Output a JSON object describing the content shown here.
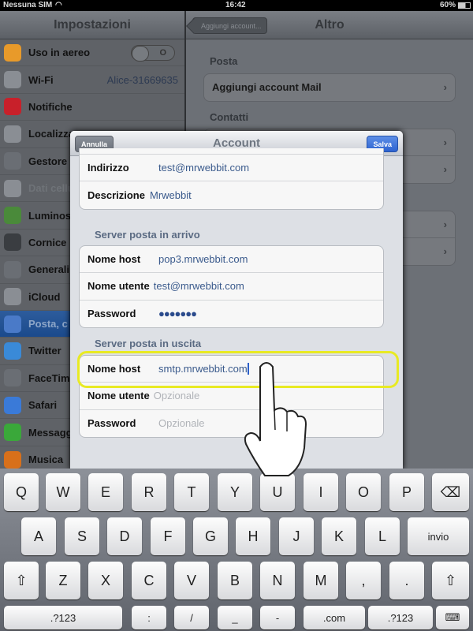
{
  "status_bar": {
    "carrier": "Nessuna SIM",
    "time": "16:42",
    "battery": "60%"
  },
  "sidebar": {
    "title": "Impostazioni",
    "items": [
      {
        "label": "Uso in aereo",
        "icon": "airplane-icon",
        "color": "#e89a2a",
        "toggle": "O"
      },
      {
        "label": "Wi-Fi",
        "icon": "wifi-icon",
        "color": "#8a8e94",
        "value": "Alice-31669635"
      },
      {
        "label": "Notifiche",
        "icon": "notifications-icon",
        "color": "#c8202a"
      },
      {
        "label": "Localizza",
        "icon": "location-icon",
        "color": "#8a8e94"
      },
      {
        "label": "Gestore",
        "icon": "carrier-icon",
        "color": "#6a6e74"
      },
      {
        "label": "Dati cellu",
        "icon": "cellular-data-icon",
        "color": "#8a8e94",
        "disabled": true
      },
      {
        "label": "Luminos",
        "icon": "brightness-icon",
        "color": "#4a8a3a"
      },
      {
        "label": "Cornice",
        "icon": "picture-frame-icon",
        "color": "#3a3d41"
      },
      {
        "label": "Generali",
        "icon": "gear-icon",
        "color": "#6a6e74"
      },
      {
        "label": "iCloud",
        "icon": "icloud-icon",
        "color": "#8a8e94"
      },
      {
        "label": "Posta, c",
        "icon": "mail-icon",
        "color": "#4a7ac8",
        "selected": true
      },
      {
        "label": "Twitter",
        "icon": "twitter-icon",
        "color": "#3a8ad8"
      },
      {
        "label": "FaceTim",
        "icon": "facetime-icon",
        "color": "#6a6e74"
      },
      {
        "label": "Safari",
        "icon": "safari-icon",
        "color": "#3a7ad8"
      },
      {
        "label": "Messagg",
        "icon": "messages-icon",
        "color": "#3aa83a"
      },
      {
        "label": "Musica",
        "icon": "music-icon",
        "color": "#d8701a"
      }
    ]
  },
  "main": {
    "back_label": "Aggiungi account...",
    "title": "Altro",
    "sections": [
      {
        "label": "Posta",
        "rows": [
          "Aggiungi account Mail"
        ]
      },
      {
        "label": "Contatti",
        "rows": [
          "",
          ""
        ]
      },
      {
        "label": "",
        "rows": [
          "",
          ""
        ]
      }
    ]
  },
  "modal": {
    "title": "Account",
    "cancel_label": "Annulla",
    "save_label": "Salva",
    "account_rows": [
      {
        "key": "Indirizzo",
        "value": "test@mrwebbit.com"
      },
      {
        "key": "Descrizione",
        "value": "Mrwebbit"
      }
    ],
    "incoming": {
      "label": "Server posta in arrivo",
      "rows": [
        {
          "key": "Nome host",
          "value": "pop3.mrwebbit.com"
        },
        {
          "key": "Nome utente",
          "value": "test@mrwebbit.com"
        },
        {
          "key": "Password",
          "value": "●●●●●●●"
        }
      ]
    },
    "outgoing": {
      "label": "Server posta in uscita",
      "rows": [
        {
          "key": "Nome host",
          "value": "smtp.mrwebbit.com"
        },
        {
          "key": "Nome utente",
          "placeholder": "Opzionale"
        },
        {
          "key": "Password",
          "placeholder": "Opzionale"
        }
      ]
    },
    "highlight_color": "#e8ea24"
  },
  "keyboard": {
    "row1": [
      "Q",
      "W",
      "E",
      "R",
      "T",
      "Y",
      "U",
      "I",
      "O",
      "P",
      "⌫"
    ],
    "row2": [
      "A",
      "S",
      "D",
      "F",
      "G",
      "H",
      "J",
      "K",
      "L",
      "invio"
    ],
    "row3": [
      "⇧",
      "Z",
      "X",
      "C",
      "V",
      "B",
      "N",
      "M",
      ",",
      ".",
      "⇧"
    ],
    "row4": [
      ".?123",
      ":",
      "/",
      "_",
      "-",
      ".com",
      ".?123",
      "⌨"
    ]
  }
}
